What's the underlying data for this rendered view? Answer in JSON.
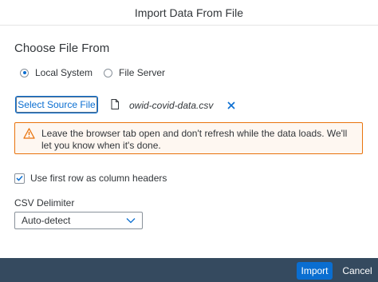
{
  "dialog": {
    "title": "Import Data From File"
  },
  "source": {
    "heading": "Choose File From",
    "options": [
      {
        "label": "Local System",
        "selected": true
      },
      {
        "label": "File Server",
        "selected": false
      }
    ]
  },
  "file": {
    "select_label": "Select Source File",
    "file_icon": "document-icon",
    "name": "owid-covid-data.csv",
    "clear_icon": "close-icon"
  },
  "warning": {
    "icon": "warning-icon",
    "text": "Leave the browser tab open and don't refresh while the data loads. We'll let you know when it's done.",
    "border_color": "#e9730c",
    "background_color": "#fef7f1"
  },
  "options": {
    "header_row_label": "Use first row as column headers",
    "header_row_checked": true
  },
  "delimiter": {
    "label": "CSV Delimiter",
    "value": "Auto-detect"
  },
  "footer": {
    "import_label": "Import",
    "cancel_label": "Cancel",
    "background_color": "#354a5f",
    "accent_color": "#0a6ed1"
  }
}
